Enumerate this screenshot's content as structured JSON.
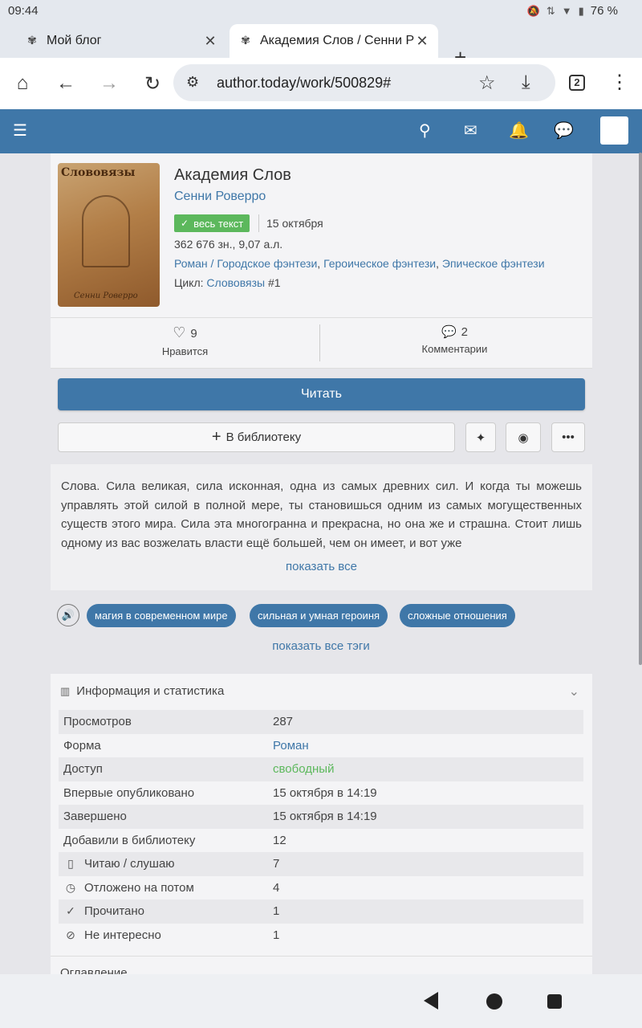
{
  "status": {
    "time": "09:44",
    "battery": "76 %"
  },
  "tabs": [
    {
      "label": "Мой блог"
    },
    {
      "label": "Академия Слов / Сенни Роверро"
    }
  ],
  "toolbar": {
    "url": "author.today/work/500829#",
    "tab_count": "2"
  },
  "book": {
    "cover_title": "Слововязы",
    "cover_author": "Сенни Роверро",
    "title": "Академия Слов",
    "author": "Сенни Роверро",
    "status_badge": "весь текст",
    "date": "15 октября",
    "size": "362 676 зн., 9,07 а.л.",
    "genres": [
      "Роман / Городское фэнтези",
      "Героическое фэнтези",
      "Эпическое фэнтези"
    ],
    "cycle_label": "Цикл:",
    "cycle_name": "Слововязы",
    "cycle_number": "#1",
    "likes": "9",
    "likes_label": "Нравится",
    "comments": "2",
    "comments_label": "Комментарии"
  },
  "actions": {
    "read": "Читать",
    "library": "В библиотеку"
  },
  "annotation": {
    "text": "Слова. Сила великая, сила исконная, одна из самых древних сил. И когда ты можешь управлять этой силой в полной мере, ты становишься одним из самых могуществен­ных существ этого мира. Сила эта многогранна и прекрасна, но она же и страшна. Стоит лишь одному из вас возжелать власти ещё большей, чем он имеет, и вот уже",
    "show_all": "показать все"
  },
  "tags": {
    "items": [
      "магия в современном мире",
      "сильная и умная героиня",
      "сложные отношения"
    ],
    "show_all": "показать все тэги"
  },
  "info": {
    "title": "Информация и статистика",
    "rows": [
      {
        "key": "Просмотров",
        "value": "287"
      },
      {
        "key": "Форма",
        "value": "Роман"
      },
      {
        "key": "Доступ",
        "value": "свободный"
      },
      {
        "key": "Впервые опубликовано",
        "value": "15 октября в 14:19"
      },
      {
        "key": "Завершено",
        "value": "15 октября в 14:19"
      },
      {
        "key": "Добавили в библиотеку",
        "value": "12"
      },
      {
        "key": "Читаю / слушаю",
        "value": "7"
      },
      {
        "key": "Отложено на потом",
        "value": "4"
      },
      {
        "key": "Прочитано",
        "value": "1"
      },
      {
        "key": "Не интересно",
        "value": "1"
      }
    ],
    "toc_label": "Оглавление"
  }
}
